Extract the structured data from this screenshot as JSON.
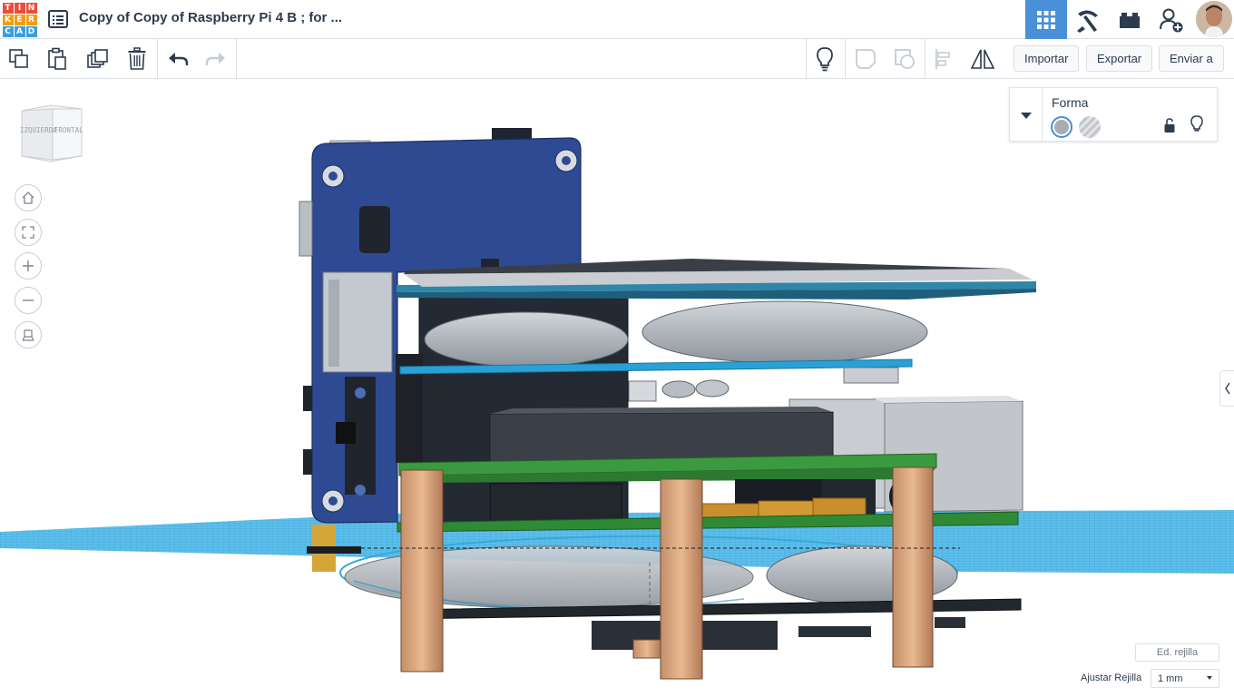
{
  "app": {
    "logo_letters": [
      "T",
      "I",
      "N",
      "K",
      "E",
      "R",
      "C",
      "A",
      "D"
    ],
    "logo_colors": [
      "#e94e3c",
      "#e94e3c",
      "#e94e3c",
      "#f39c12",
      "#f39c12",
      "#f39c12",
      "#3aa0d9",
      "#3aa0d9",
      "#3aa0d9"
    ],
    "document_title": "Copy of Copy of Raspberry Pi 4 B ; for ...",
    "accent": "#4a90d9"
  },
  "header": {
    "buttons": [
      {
        "name": "3d-design-view",
        "icon": "grid-icon",
        "active": true
      },
      {
        "name": "codeblocks-view",
        "icon": "pickaxe-icon",
        "active": false
      },
      {
        "name": "bricks-view",
        "icon": "brick-icon",
        "active": false
      },
      {
        "name": "invite-user",
        "icon": "add-user-icon",
        "active": false
      }
    ]
  },
  "toolbar": {
    "copy_icon": "copy-icon",
    "paste_icon": "paste-icon",
    "duplicate_icon": "duplicate-icon",
    "delete_icon": "trash-icon",
    "undo_icon": "undo-icon",
    "redo_icon": "redo-icon",
    "notes_icon": "lightbulb-icon",
    "group_icon": "group-icon",
    "ungroup_icon": "ungroup-icon",
    "align_icon": "align-icon",
    "mirror_icon": "mirror-icon",
    "import_label": "Importar",
    "export_label": "Exportar",
    "send_label": "Enviar a"
  },
  "viewcube": {
    "left_face": "IZQUIERDA",
    "front_face": "FRONTAL"
  },
  "inspector": {
    "title": "Forma",
    "solid_color": "#a9adb2",
    "hole_pattern": "hatched"
  },
  "grid": {
    "edit_label": "Ed. rejilla",
    "snap_label": "Ajustar Rejilla",
    "snap_value": "1 mm"
  }
}
